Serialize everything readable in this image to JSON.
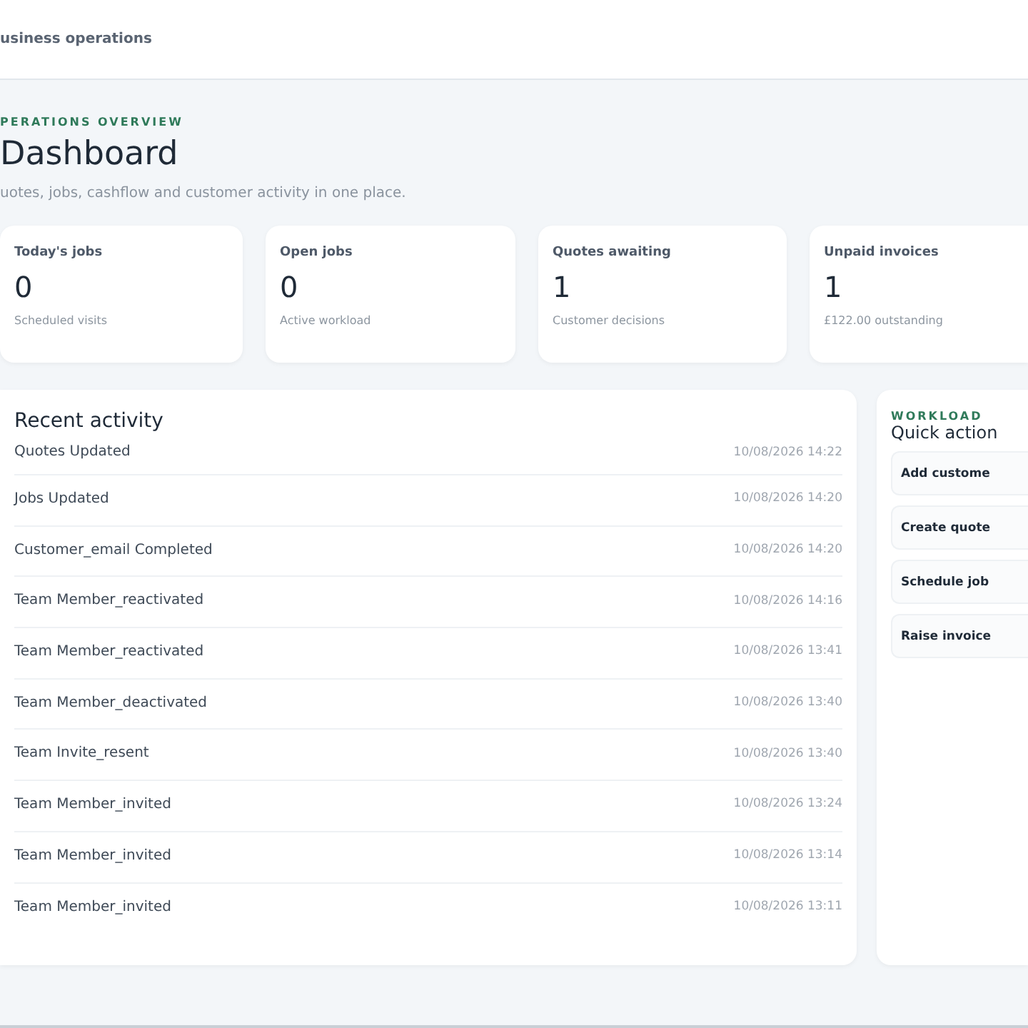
{
  "header": {
    "title": "usiness operations"
  },
  "overview": {
    "eyebrow": "PERATIONS OVERVIEW",
    "title": "Dashboard",
    "subtitle": "uotes, jobs, cashflow and customer activity in one place."
  },
  "stats": [
    {
      "label": "Today's jobs",
      "value": "0",
      "note": "Scheduled visits"
    },
    {
      "label": "Open jobs",
      "value": "0",
      "note": "Active workload"
    },
    {
      "label": "Quotes awaiting",
      "value": "1",
      "note": "Customer decisions"
    },
    {
      "label": "Unpaid invoices",
      "value": "1",
      "note": "£122.00 outstanding"
    }
  ],
  "activity": {
    "title": "Recent activity",
    "rows": [
      {
        "event": "Quotes Updated",
        "time": "10/08/2026 14:22"
      },
      {
        "event": "Jobs Updated",
        "time": "10/08/2026 14:20"
      },
      {
        "event": "Customer_email Completed",
        "time": "10/08/2026 14:20"
      },
      {
        "event": "Team Member_reactivated",
        "time": "10/08/2026 14:16"
      },
      {
        "event": "Team Member_reactivated",
        "time": "10/08/2026 13:41"
      },
      {
        "event": "Team Member_deactivated",
        "time": "10/08/2026 13:40"
      },
      {
        "event": "Team Invite_resent",
        "time": "10/08/2026 13:40"
      },
      {
        "event": "Team Member_invited",
        "time": "10/08/2026 13:24"
      },
      {
        "event": "Team Member_invited",
        "time": "10/08/2026 13:14"
      },
      {
        "event": "Team Member_invited",
        "time": "10/08/2026 13:11"
      }
    ]
  },
  "quick_actions": {
    "eyebrow": "WORKLOAD",
    "title": "Quick action",
    "buttons": [
      "Add custome",
      "Create quote",
      "Schedule job",
      "Raise invoice"
    ]
  }
}
